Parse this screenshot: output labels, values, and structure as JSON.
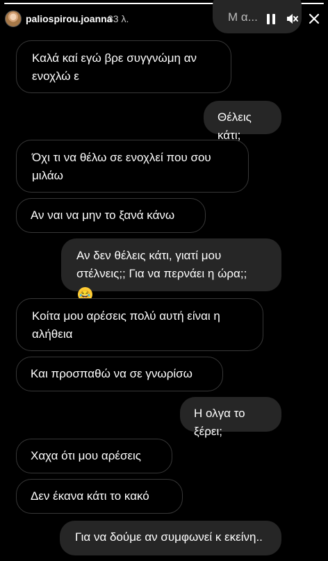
{
  "story": {
    "username": "paliospirou.joanna",
    "time": "33 λ.",
    "progress": 1.0
  },
  "header_icons": [
    "pause-icon",
    "mute-icon",
    "close-icon"
  ],
  "partial_top_text": "Μ α...  ",
  "messages": [
    {
      "side": "received",
      "text": "Καλά καί εγώ βρε συγγνώμη αν ενοχλώ ε"
    },
    {
      "side": "sent",
      "text": "Θέλεις κάτι;"
    },
    {
      "side": "received",
      "text": "Όχι τι να θέλω σε ενοχλεί που σου μιλάω"
    },
    {
      "side": "received",
      "text": "Αν ναι να μην το ξανά κάνω"
    },
    {
      "side": "sent",
      "text": "Αν δεν θέλεις κάτι, γιατί μου στέλνεις;; Για να περνάει η ώρα;;",
      "emoji": "😂"
    },
    {
      "side": "received",
      "text": "Κοίτα μου αρέσεις πολύ αυτή είναι η αλήθεια"
    },
    {
      "side": "received",
      "text": "Και προσπαθώ να σε γνωρίσω"
    },
    {
      "side": "sent",
      "text": "Η ολγα το ξέρει;"
    },
    {
      "side": "received",
      "text": "Χαχα  ότι μου αρέσεις"
    },
    {
      "side": "received",
      "text": "Δεν έκανα κάτι το κακό"
    },
    {
      "side": "sent",
      "text": "Για να δούμε αν συμφωνεί κ εκείνη.."
    }
  ],
  "colors": {
    "background": "#000000",
    "sent_bubble": "#262626",
    "received_border": "#383838"
  }
}
